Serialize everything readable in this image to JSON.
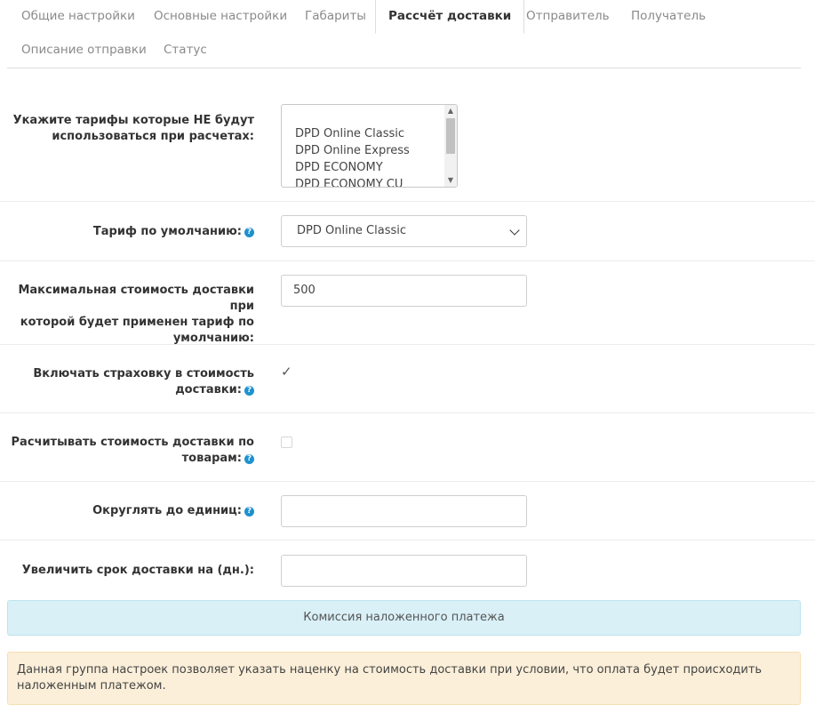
{
  "tabs": [
    {
      "label": "Общие настройки",
      "active": false
    },
    {
      "label": "Основные настройки",
      "active": false
    },
    {
      "label": "Габариты",
      "active": false
    },
    {
      "label": "Рассчёт доставки",
      "active": true
    },
    {
      "label": "Отправитель",
      "active": false
    },
    {
      "label": "Получатель",
      "active": false
    },
    {
      "label": "Описание отправки",
      "active": false
    },
    {
      "label": "Статус",
      "active": false
    }
  ],
  "fields": {
    "excluded_tariffs": {
      "label_line1": "Укажите тарифы которые НЕ будут",
      "label_line2": "использоваться при расчетах:",
      "options": [
        "DPD Online Classic",
        "DPD Online Express",
        "DPD ECONOMY",
        "DPD ECONOMY CU"
      ]
    },
    "default_tariff": {
      "label": "Тариф по умолчанию:",
      "value": "DPD Online Classic"
    },
    "max_cost": {
      "label_line1": "Максимальная стоимость доставки при",
      "label_line2": "которой будет применен тариф по",
      "label_line3": "умолчанию:",
      "value": "500"
    },
    "insurance": {
      "label_line1": "Включать страховку в стоимость",
      "label_line2": "доставки:",
      "checked": true
    },
    "calc_by_goods": {
      "label_line1": "Расчитывать стоимость доставки по",
      "label_line2": "товарам:",
      "checked": false
    },
    "rounding": {
      "label": "Округлять до единиц:",
      "value": ""
    },
    "extra_days": {
      "label": "Увеличить срок доставки на (дн.):",
      "value": ""
    }
  },
  "cod_panel": {
    "title": "Комиссия наложенного платежа",
    "note": "Данная группа настроек позволяет указать наценку на стоимость доставки при условии, что оплата будет происходить наложенным платежом."
  },
  "help_icon_glyph": "?",
  "colors": {
    "help_icon": "#1e91cf",
    "info_panel": "#d9f0f7",
    "warning_panel": "#fcefd9"
  }
}
